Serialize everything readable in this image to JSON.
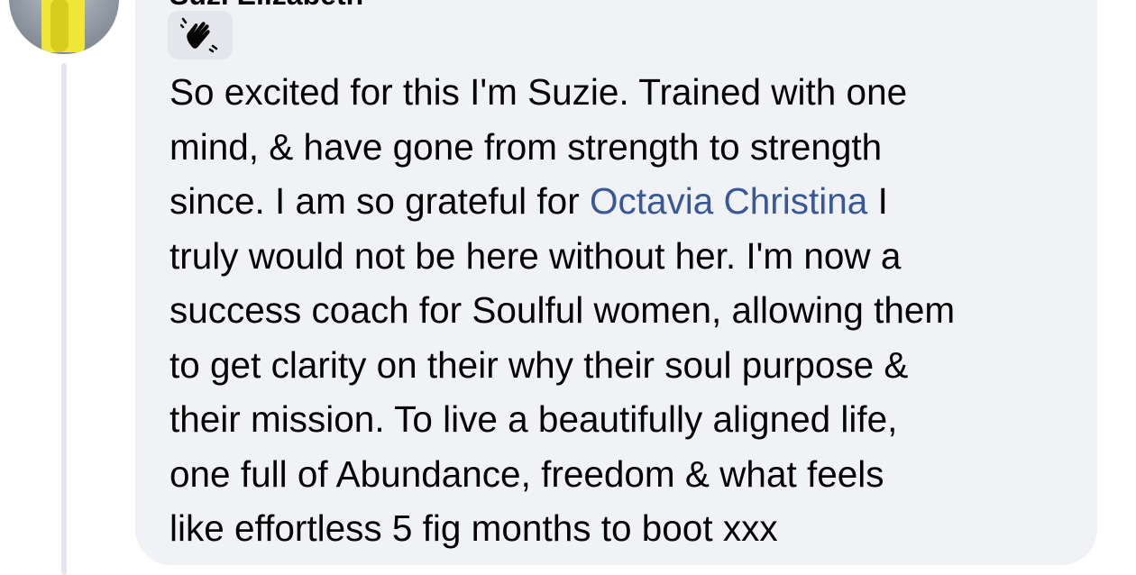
{
  "comment": {
    "author": "Suzi Elizabeth",
    "reaction_icon": "waving-hand-icon",
    "lines": [
      {
        "before": "So excited for this I'm Suzie. Trained with one"
      },
      {
        "before": "mind, &  have gone from strength to strength"
      },
      {
        "before": "since. I am so grateful for ",
        "mention": "Octavia Christina",
        "after": " I"
      },
      {
        "before": "truly would not be here without her. I'm now a"
      },
      {
        "before": "success coach for Soulful women, allowing them"
      },
      {
        "before": "to get clarity on their why their soul purpose &"
      },
      {
        "before": "their mission. To live a beautifully aligned life,"
      },
      {
        "before": "one full of Abundance, freedom &  what feels"
      },
      {
        "before": "like effortless 5 fig months to boot xxx"
      }
    ]
  },
  "colors": {
    "bubble_bg": "#f0f2f5",
    "mention": "#385898",
    "text": "#050505",
    "thread_line": "#e4e6eb"
  }
}
